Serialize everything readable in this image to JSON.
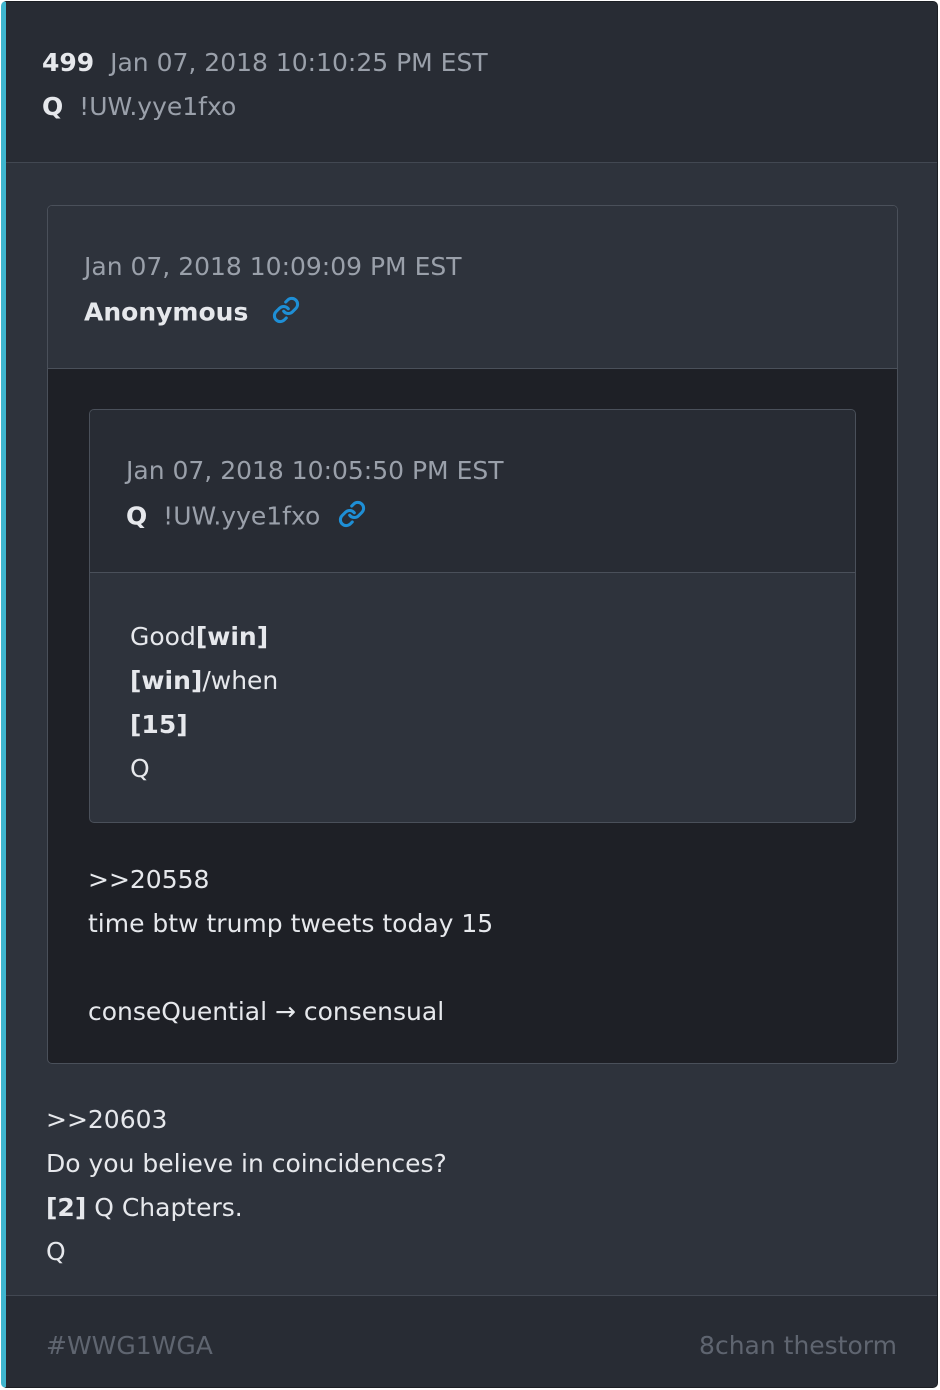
{
  "post": {
    "number": "499",
    "timestamp": "Jan 07, 2018 10:10:25 PM EST",
    "author": "Q",
    "tripcode": "!UW.yye1fxo"
  },
  "quoted_post": {
    "timestamp": "Jan 07, 2018 10:09:09 PM EST",
    "author": "Anonymous",
    "link_icon": "link-icon",
    "nested_quote": {
      "timestamp": "Jan 07, 2018 10:05:50 PM EST",
      "author": "Q",
      "tripcode": "!UW.yye1fxo",
      "link_icon": "link-icon",
      "body": {
        "line1_text": "Good",
        "line1_bold": "[win]",
        "line2_bold": "[win]",
        "line2_text": "/when",
        "line3_bold": "[15]",
        "line4_text": "Q"
      }
    },
    "body": {
      "line1": ">>20558",
      "line2": "time btw trump tweets today 15",
      "line3": "conseQuential → consensual"
    }
  },
  "body": {
    "line1": ">>20603",
    "line2": "Do you believe in coincidences?",
    "line3_bold": "[2]",
    "line3_text": " Q Chapters.",
    "line4": "Q"
  },
  "footer": {
    "hashtag": "#WWG1WGA",
    "source": "8chan thestorm"
  },
  "colors": {
    "accent": "#3fb6cf",
    "link_icon": "#1e8fd6",
    "background": "#2e333c",
    "dark_panel": "#1e2026"
  }
}
